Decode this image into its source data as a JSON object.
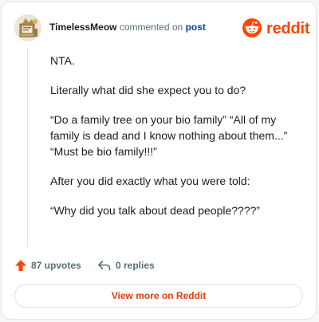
{
  "header": {
    "username": "TimelessMeow",
    "action_text": "commented on",
    "post_link": "post",
    "brand": "reddit"
  },
  "comment": {
    "paragraphs": [
      "NTA.",
      "Literally what did she expect you to do?",
      "“Do a family tree on your bio family” “All of my family is dead and I know nothing about them...” “Must be bio family!!!”",
      "After you did exactly what you were told:",
      "“Why did you talk about dead people????”"
    ]
  },
  "actions": {
    "upvotes": "87 upvotes",
    "replies": "0 replies"
  },
  "footer": {
    "view_more": "View more on Reddit"
  },
  "colors": {
    "brand": "#ff4500",
    "link": "#0a449b",
    "button_text": "#e03d00"
  },
  "icons": {
    "avatar": "avatar-icon",
    "logo": "reddit-snoo-icon",
    "upvote": "upvote-arrow-icon",
    "reply": "reply-arrow-icon"
  }
}
